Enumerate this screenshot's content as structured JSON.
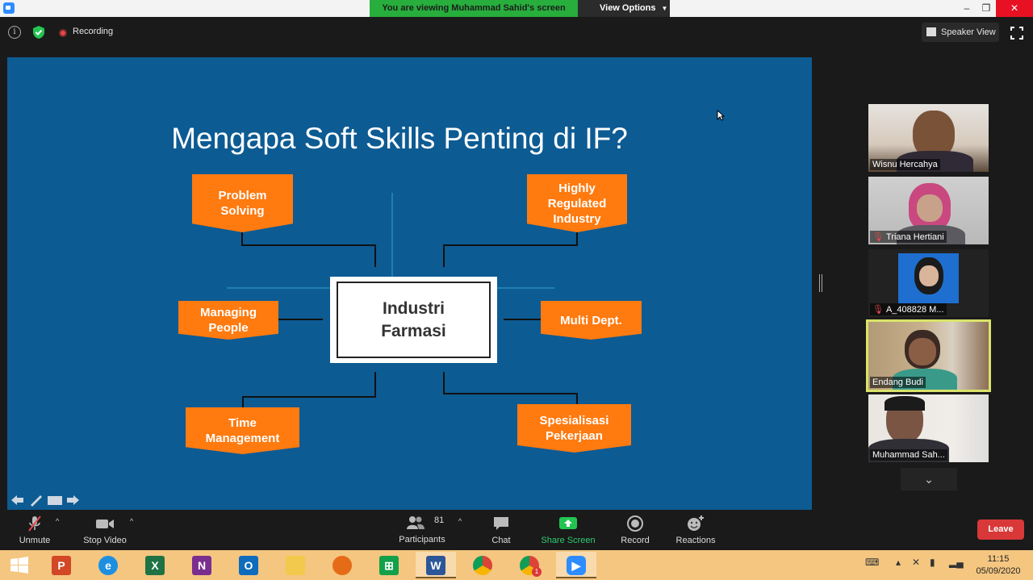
{
  "window": {
    "viewing_banner": "You are viewing Muhammad Sahid's screen",
    "view_options": "View Options",
    "minimize": "–",
    "restore": "❐",
    "close": "✕"
  },
  "topbar": {
    "recording_label": "Recording",
    "speaker_view_label": "Speaker View"
  },
  "slide": {
    "title": "Mengapa Soft Skills Penting di IF?",
    "center": [
      "Industri",
      "Farmasi"
    ],
    "badges": {
      "problem_solving": [
        "Problem",
        "Solving"
      ],
      "highly_regulated": [
        "Highly",
        "Regulated",
        "Industry"
      ],
      "managing_people": [
        "Managing",
        "People"
      ],
      "multi_dept": [
        "Multi Dept."
      ],
      "time_management": [
        "Time",
        "Management"
      ],
      "spesialisasi": [
        "Spesialisasi",
        "Pekerjaan"
      ]
    },
    "colors": {
      "background": "#0d5b93",
      "badge": "#ff7a0f"
    }
  },
  "gallery": {
    "participants": [
      {
        "name": "Wisnu Hercahya",
        "muted": false
      },
      {
        "name": "Triana Hertiani",
        "muted": true
      },
      {
        "name": "A_408828 M...",
        "muted": true
      },
      {
        "name": "Endang Budi",
        "muted": false,
        "active": true
      },
      {
        "name": "Muhammad Sah...",
        "muted": false
      }
    ]
  },
  "toolbar": {
    "unmute": "Unmute",
    "stop_video": "Stop Video",
    "participants_count": "81",
    "participants": "Participants",
    "chat": "Chat",
    "share_screen": "Share Screen",
    "record": "Record",
    "reactions": "Reactions",
    "leave": "Leave"
  },
  "taskbar": {
    "time": "11:15",
    "date": "05/09/2020",
    "chrome_badge": "1"
  }
}
